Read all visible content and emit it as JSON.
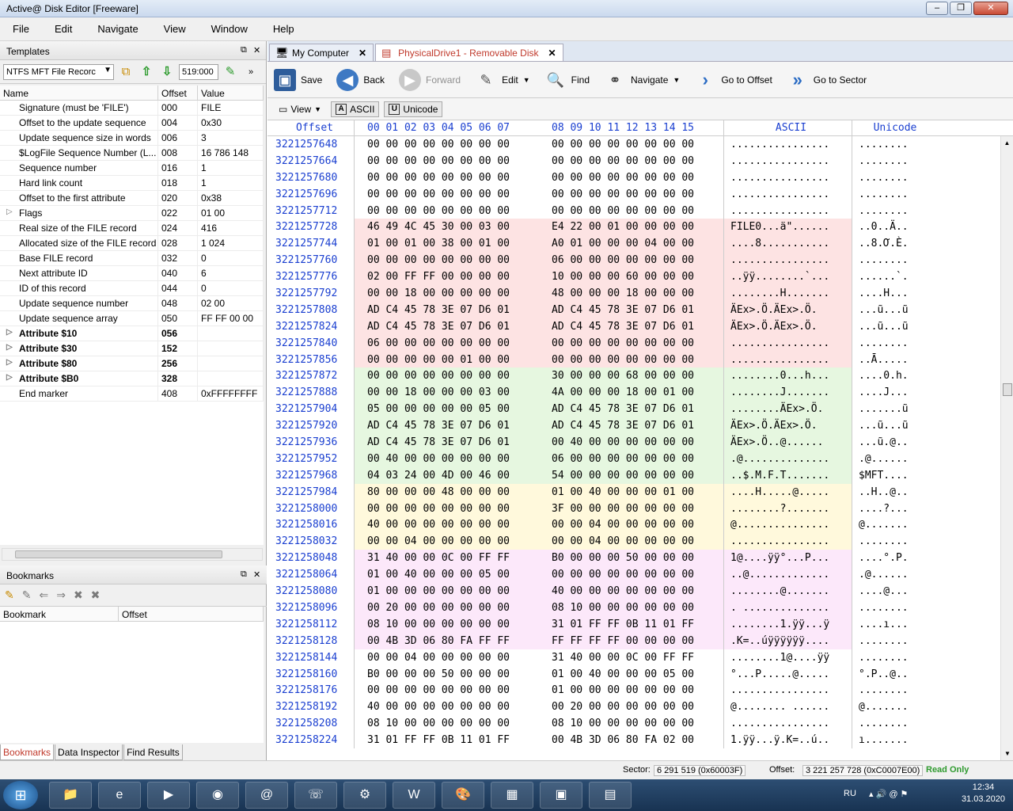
{
  "window": {
    "title": "Active@ Disk Editor [Freeware]"
  },
  "menu": [
    "File",
    "Edit",
    "Navigate",
    "View",
    "Window",
    "Help"
  ],
  "templates": {
    "header": "Templates",
    "combo_value": "NTFS MFT File Recorc",
    "offset_value": "519:000",
    "columns": [
      "Name",
      "Offset",
      "Value"
    ],
    "rows": [
      {
        "name": "Signature (must be 'FILE')",
        "offset": "000",
        "value": "FILE",
        "expandable": false,
        "bold": false
      },
      {
        "name": "Offset to the update sequence",
        "offset": "004",
        "value": "0x30",
        "expandable": false,
        "bold": false
      },
      {
        "name": "Update sequence size in words",
        "offset": "006",
        "value": "3",
        "expandable": false,
        "bold": false
      },
      {
        "name": "$LogFile Sequence Number (L...",
        "offset": "008",
        "value": "16 786 148",
        "expandable": false,
        "bold": false
      },
      {
        "name": "Sequence number",
        "offset": "016",
        "value": "1",
        "expandable": false,
        "bold": false
      },
      {
        "name": "Hard link count",
        "offset": "018",
        "value": "1",
        "expandable": false,
        "bold": false
      },
      {
        "name": "Offset to the first attribute",
        "offset": "020",
        "value": "0x38",
        "expandable": false,
        "bold": false
      },
      {
        "name": "Flags",
        "offset": "022",
        "value": "01 00",
        "expandable": true,
        "bold": false
      },
      {
        "name": "Real size of the FILE record",
        "offset": "024",
        "value": "416",
        "expandable": false,
        "bold": false
      },
      {
        "name": "Allocated size of the FILE record",
        "offset": "028",
        "value": "1 024",
        "expandable": false,
        "bold": false
      },
      {
        "name": "Base FILE record",
        "offset": "032",
        "value": "0",
        "expandable": false,
        "bold": false
      },
      {
        "name": "Next attribute ID",
        "offset": "040",
        "value": "6",
        "expandable": false,
        "bold": false
      },
      {
        "name": "ID of this record",
        "offset": "044",
        "value": "0",
        "expandable": false,
        "bold": false
      },
      {
        "name": "Update sequence number",
        "offset": "048",
        "value": "02 00",
        "expandable": false,
        "bold": false
      },
      {
        "name": "Update sequence array",
        "offset": "050",
        "value": "FF FF 00 00",
        "expandable": false,
        "bold": false
      },
      {
        "name": "Attribute $10",
        "offset": "056",
        "value": "",
        "expandable": true,
        "bold": true
      },
      {
        "name": "Attribute $30",
        "offset": "152",
        "value": "",
        "expandable": true,
        "bold": true
      },
      {
        "name": "Attribute $80",
        "offset": "256",
        "value": "",
        "expandable": true,
        "bold": true
      },
      {
        "name": "Attribute $B0",
        "offset": "328",
        "value": "",
        "expandable": true,
        "bold": true
      },
      {
        "name": "End marker",
        "offset": "408",
        "value": "0xFFFFFFFF",
        "expandable": false,
        "bold": false
      }
    ]
  },
  "bookmarks": {
    "header": "Bookmarks",
    "columns": [
      "Bookmark",
      "Offset"
    ]
  },
  "bottom_tabs": [
    "Bookmarks",
    "Data Inspector",
    "Find Results"
  ],
  "doc_tabs": [
    {
      "label": "My Computer",
      "active": false
    },
    {
      "label": "PhysicalDrive1 - Removable Disk",
      "active": true
    }
  ],
  "toolbar": {
    "save": "Save",
    "back": "Back",
    "forward": "Forward",
    "edit": "Edit",
    "find": "Find",
    "navigate": "Navigate",
    "goto_offset": "Go to Offset",
    "goto_sector": "Go to Sector"
  },
  "viewbar": {
    "view": "View",
    "ascii": "ASCII",
    "unicode": "Unicode"
  },
  "hex_header": {
    "offset": "Offset",
    "h1": "00 01 02 03 04 05 06 07",
    "h2": "08 09 10 11 12 13 14 15",
    "ascii": "ASCII",
    "unicode": "Unicode"
  },
  "hex_rows": [
    {
      "off": "3221257648",
      "h1": "00 00 00 00 00 00 00 00",
      "h2": "00 00 00 00 00 00 00 00",
      "asc": "................",
      "uni": "........",
      "hl": ""
    },
    {
      "off": "3221257664",
      "h1": "00 00 00 00 00 00 00 00",
      "h2": "00 00 00 00 00 00 00 00",
      "asc": "................",
      "uni": "........",
      "hl": ""
    },
    {
      "off": "3221257680",
      "h1": "00 00 00 00 00 00 00 00",
      "h2": "00 00 00 00 00 00 00 00",
      "asc": "................",
      "uni": "........",
      "hl": ""
    },
    {
      "off": "3221257696",
      "h1": "00 00 00 00 00 00 00 00",
      "h2": "00 00 00 00 00 00 00 00",
      "asc": "................",
      "uni": "........",
      "hl": ""
    },
    {
      "off": "3221257712",
      "h1": "00 00 00 00 00 00 00 00",
      "h2": "00 00 00 00 00 00 00 00",
      "asc": "................",
      "uni": "........",
      "hl": ""
    },
    {
      "off": "3221257728",
      "h1": "46 49 4C 45 30 00 03 00",
      "h2": "E4 22 00 01 00 00 00 00",
      "asc": "FILE0...ä\"......",
      "uni": "..0..Ä..",
      "hl": "hl-red"
    },
    {
      "off": "3221257744",
      "h1": "01 00 01 00 38 00 01 00",
      "h2": "A0 01 00 00 00 04 00 00",
      "asc": "....8...........",
      "uni": "..8.Ơ.È.",
      "hl": "hl-red"
    },
    {
      "off": "3221257760",
      "h1": "00 00 00 00 00 00 00 00",
      "h2": "06 00 00 00 00 00 00 00",
      "asc": "................",
      "uni": "........",
      "hl": "hl-red"
    },
    {
      "off": "3221257776",
      "h1": "02 00 FF FF 00 00 00 00",
      "h2": "10 00 00 00 60 00 00 00",
      "asc": "..ÿÿ........`...",
      "uni": "......`.",
      "hl": "hl-red"
    },
    {
      "off": "3221257792",
      "h1": "00 00 18 00 00 00 00 00",
      "h2": "48 00 00 00 18 00 00 00",
      "asc": "........H.......",
      "uni": "....H...",
      "hl": "hl-red"
    },
    {
      "off": "3221257808",
      "h1": "AD C4 45 78 3E 07 D6 01",
      "h2": "AD C4 45 78 3E 07 D6 01",
      "asc": "ÄEx>.Ö.ÄEx>.Ö.",
      "uni": "...ũ...ũ",
      "hl": "hl-red"
    },
    {
      "off": "3221257824",
      "h1": "AD C4 45 78 3E 07 D6 01",
      "h2": "AD C4 45 78 3E 07 D6 01",
      "asc": "ÄEx>.Ö.ÄEx>.Ö.",
      "uni": "...ũ...ũ",
      "hl": "hl-red"
    },
    {
      "off": "3221257840",
      "h1": "06 00 00 00 00 00 00 00",
      "h2": "00 00 00 00 00 00 00 00",
      "asc": "................",
      "uni": "........",
      "hl": "hl-red"
    },
    {
      "off": "3221257856",
      "h1": "00 00 00 00 00 01 00 00",
      "h2": "00 00 00 00 00 00 00 00",
      "asc": "................",
      "uni": "..Ā.....",
      "hl": "hl-red"
    },
    {
      "off": "3221257872",
      "h1": "00 00 00 00 00 00 00 00",
      "h2": "30 00 00 00 68 00 00 00",
      "asc": "........0...h...",
      "uni": "....0.h.",
      "hl": "hl-grn"
    },
    {
      "off": "3221257888",
      "h1": "00 00 18 00 00 00 03 00",
      "h2": "4A 00 00 00 18 00 01 00",
      "asc": "........J.......",
      "uni": "....J...",
      "hl": "hl-grn"
    },
    {
      "off": "3221257904",
      "h1": "05 00 00 00 00 00 05 00",
      "h2": "AD C4 45 78 3E 07 D6 01",
      "asc": "........ÄEx>.Ö.",
      "uni": ".......ũ",
      "hl": "hl-grn"
    },
    {
      "off": "3221257920",
      "h1": "AD C4 45 78 3E 07 D6 01",
      "h2": "AD C4 45 78 3E 07 D6 01",
      "asc": "ÄEx>.Ö.ÄEx>.Ö.",
      "uni": "...ũ...ũ",
      "hl": "hl-grn"
    },
    {
      "off": "3221257936",
      "h1": "AD C4 45 78 3E 07 D6 01",
      "h2": "00 40 00 00 00 00 00 00",
      "asc": "ÄEx>.Ö..@......",
      "uni": "...ũ.@..",
      "hl": "hl-grn"
    },
    {
      "off": "3221257952",
      "h1": "00 40 00 00 00 00 00 00",
      "h2": "06 00 00 00 00 00 00 00",
      "asc": ".@..............",
      "uni": ".@......",
      "hl": "hl-grn"
    },
    {
      "off": "3221257968",
      "h1": "04 03 24 00 4D 00 46 00",
      "h2": "54 00 00 00 00 00 00 00",
      "asc": "..$.M.F.T.......",
      "uni": "$MFT....",
      "hl": "hl-grn"
    },
    {
      "off": "3221257984",
      "h1": "80 00 00 00 48 00 00 00",
      "h2": "01 00 40 00 00 00 01 00",
      "asc": "....H.....@.....",
      "uni": "..H..@..",
      "hl": "hl-yel"
    },
    {
      "off": "3221258000",
      "h1": "00 00 00 00 00 00 00 00",
      "h2": "3F 00 00 00 00 00 00 00",
      "asc": "........?.......",
      "uni": "....?...",
      "hl": "hl-yel"
    },
    {
      "off": "3221258016",
      "h1": "40 00 00 00 00 00 00 00",
      "h2": "00 00 04 00 00 00 00 00",
      "asc": "@...............",
      "uni": "@.......",
      "hl": "hl-yel"
    },
    {
      "off": "3221258032",
      "h1": "00 00 04 00 00 00 00 00",
      "h2": "00 00 04 00 00 00 00 00",
      "asc": "................",
      "uni": "........",
      "hl": "hl-yel"
    },
    {
      "off": "3221258048",
      "h1": "31 40 00 00 0C 00 FF FF",
      "h2": "B0 00 00 00 50 00 00 00",
      "asc": "1@....ÿÿ°...P...",
      "uni": "....°.P.",
      "hl": "hl-pnk"
    },
    {
      "off": "3221258064",
      "h1": "01 00 40 00 00 00 05 00",
      "h2": "00 00 00 00 00 00 00 00",
      "asc": "..@.............",
      "uni": ".@......",
      "hl": "hl-pnk"
    },
    {
      "off": "3221258080",
      "h1": "01 00 00 00 00 00 00 00",
      "h2": "40 00 00 00 00 00 00 00",
      "asc": "........@.......",
      "uni": "....@...",
      "hl": "hl-pnk"
    },
    {
      "off": "3221258096",
      "h1": "00 20 00 00 00 00 00 00",
      "h2": "08 10 00 00 00 00 00 00",
      "asc": ". ..............",
      "uni": "........",
      "hl": "hl-pnk"
    },
    {
      "off": "3221258112",
      "h1": "08 10 00 00 00 00 00 00",
      "h2": "31 01 FF FF 0B 11 01 FF",
      "asc": "........1.ÿÿ...ÿ",
      "uni": "....ı...",
      "hl": "hl-pnk"
    },
    {
      "off": "3221258128",
      "h1": "00 4B 3D 06 80 FA FF FF",
      "h2": "FF FF FF FF 00 00 00 00",
      "asc": ".K=..úÿÿÿÿÿÿ....",
      "uni": "........",
      "hl": "hl-pnk"
    },
    {
      "off": "3221258144",
      "h1": "00 00 04 00 00 00 00 00",
      "h2": "31 40 00 00 0C 00 FF FF",
      "asc": "........1@....ÿÿ",
      "uni": "........",
      "hl": ""
    },
    {
      "off": "3221258160",
      "h1": "B0 00 00 00 50 00 00 00",
      "h2": "01 00 40 00 00 00 05 00",
      "asc": "°...P.....@.....",
      "uni": "°.P..@..",
      "hl": ""
    },
    {
      "off": "3221258176",
      "h1": "00 00 00 00 00 00 00 00",
      "h2": "01 00 00 00 00 00 00 00",
      "asc": "................",
      "uni": "........",
      "hl": ""
    },
    {
      "off": "3221258192",
      "h1": "40 00 00 00 00 00 00 00",
      "h2": "00 20 00 00 00 00 00 00",
      "asc": "@........ ......",
      "uni": "@.......",
      "hl": ""
    },
    {
      "off": "3221258208",
      "h1": "08 10 00 00 00 00 00 00",
      "h2": "08 10 00 00 00 00 00 00",
      "asc": "................",
      "uni": "........",
      "hl": ""
    },
    {
      "off": "3221258224",
      "h1": "31 01 FF FF 0B 11 01 FF",
      "h2": "00 4B 3D 06 80 FA 02 00",
      "asc": "1.ÿÿ...ÿ.K=..ú..",
      "uni": "ı.......",
      "hl": ""
    }
  ],
  "status": {
    "sector_label": "Sector:",
    "sector_value": "6 291 519 (0x60003F)",
    "offset_label": "Offset:",
    "offset_value": "3 221 257 728 (0xC0007E00)",
    "mode": "Read Only"
  },
  "taskbar": {
    "lang": "RU",
    "time": "12:34",
    "date": "31.03.2020"
  },
  "colors": {
    "accent": "#c0392b",
    "offset_blue": "#1a3fd0",
    "read_only": "#2f9a2f"
  }
}
